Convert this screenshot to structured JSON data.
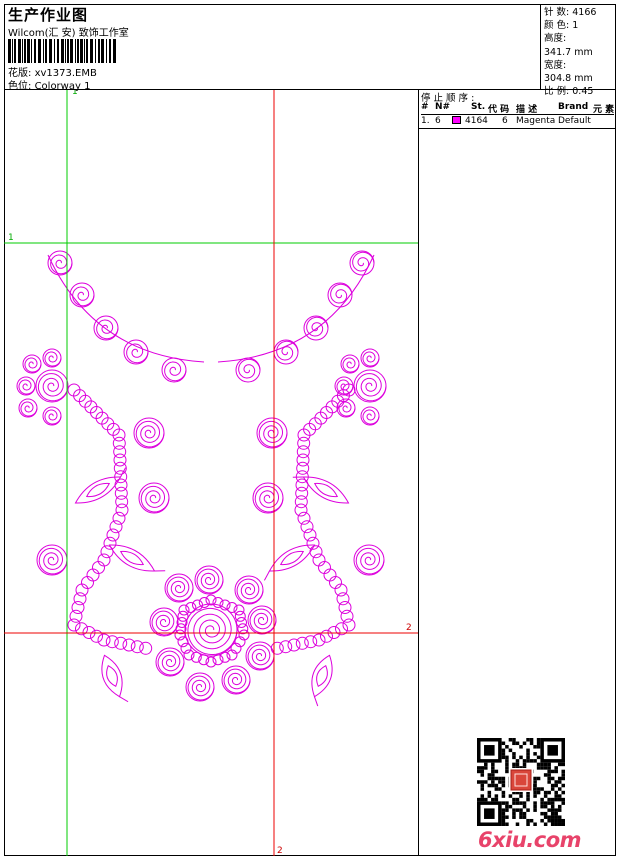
{
  "header": {
    "title": "生产作业图",
    "company": "Wilcom(汇 安) 致饰工作室",
    "design_label": "花版:",
    "design_value": "xv1373.EMB",
    "colorway_label": "色位:",
    "colorway_value": "Colorway 1"
  },
  "stats": [
    {
      "label": "针 数:",
      "value": "4166"
    },
    {
      "label": "颜 色:",
      "value": "1"
    },
    {
      "label": "高度:",
      "value": "341.7 mm"
    },
    {
      "label": "宽度:",
      "value": "304.8 mm"
    },
    {
      "label": "比 例:",
      "value": "0.45"
    }
  ],
  "stop_sequence": {
    "title": "停 止 顺 序 :",
    "headers": {
      "num": "#",
      "n": "N#",
      "st": "St.",
      "code": "代 码",
      "desc": "描 述",
      "brand": "Brand",
      "element": "元 素"
    },
    "rows": [
      {
        "num": "1.",
        "n": "6",
        "st": "4164",
        "code": "6",
        "desc": "Magenta",
        "brand": "Default",
        "color": "#ff00ff"
      }
    ]
  },
  "guides": {
    "v1": "1",
    "h1": "1",
    "h2": "2",
    "v2": "2"
  },
  "colors": {
    "thread": "#dd00dd",
    "guide_green": "#00cc00",
    "guide_red": "#ee0000",
    "watermark": "#e8436a"
  },
  "watermark": "6xiu.com",
  "icons": {
    "barcode": "barcode-icon",
    "qr": "qr-code-icon",
    "seal": "red-seal-icon"
  }
}
